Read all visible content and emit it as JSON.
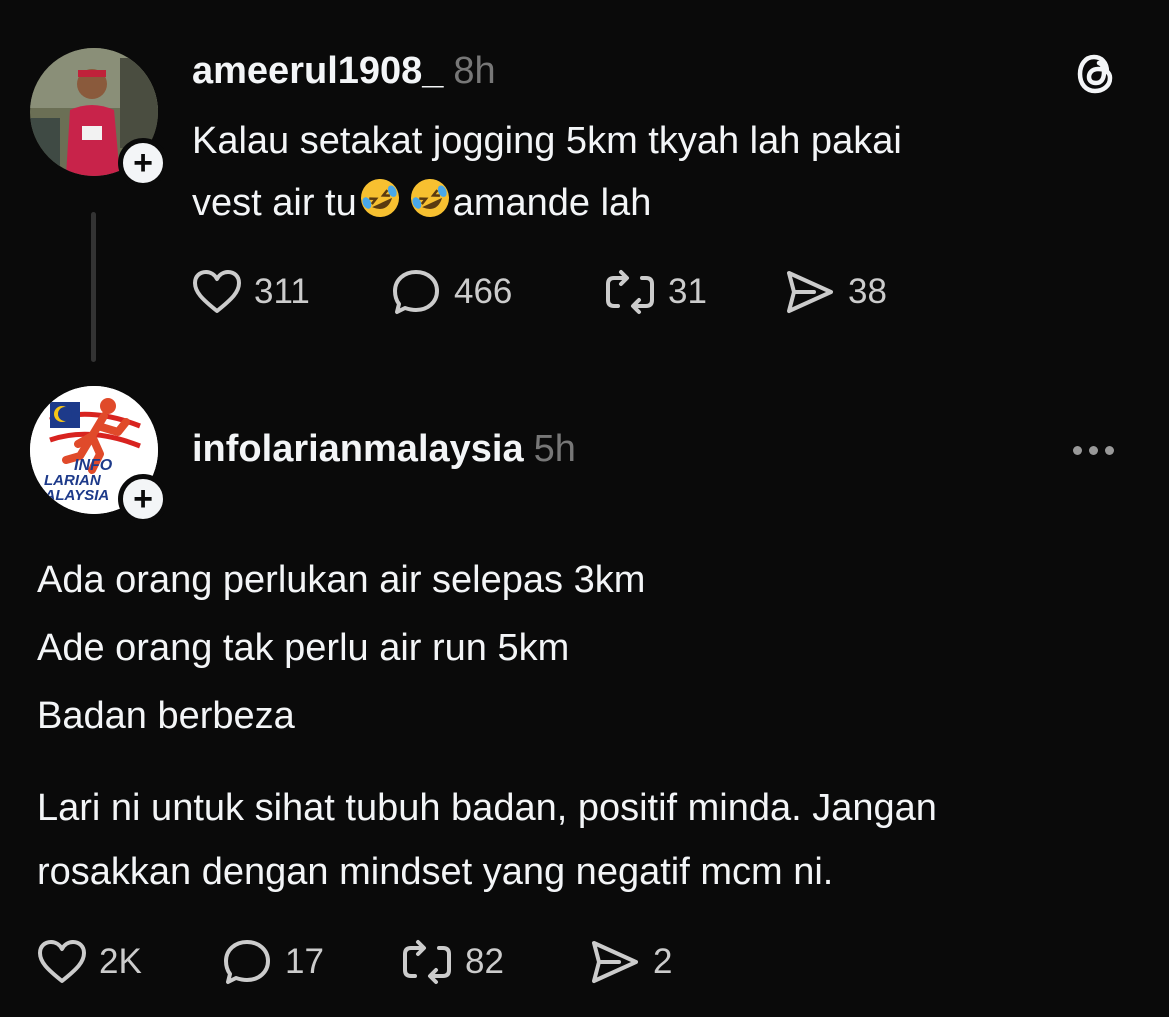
{
  "post1": {
    "username": "ameerul1908_",
    "time": "8h",
    "text_line1": "Kalau setakat jogging 5km tkyah lah pakai",
    "text_line2_a": "vest air tu",
    "text_line2_b": "amande lah",
    "emoji": "rolling-on-floor-laughing",
    "likes": "311",
    "replies": "466",
    "reposts": "31",
    "shares": "38"
  },
  "post2": {
    "username": "infolarianmalaysia",
    "time": "5h",
    "avatar_text": [
      "INFO",
      "LARIAN",
      "MALAYSIA"
    ],
    "lines": [
      "Ada orang perlukan air selepas 3km",
      "Ade orang tak perlu air run 5km",
      "Badan berbeza"
    ],
    "para_line1": "Lari ni untuk sihat tubuh badan, positif minda. Jangan",
    "para_line2": "rosakkan dengan mindset yang negatif mcm ni.",
    "likes": "2K",
    "replies": "17",
    "reposts": "82",
    "shares": "2"
  },
  "colors": {
    "background": "#0a0a0a",
    "text": "#f3f5f7",
    "muted": "#777777"
  }
}
